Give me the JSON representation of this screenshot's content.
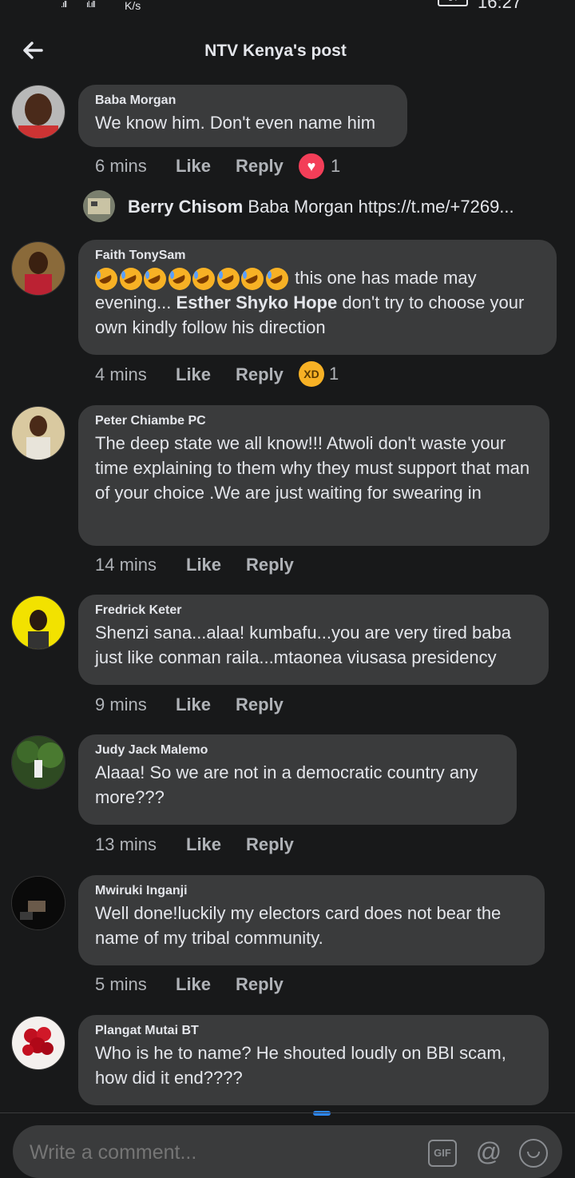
{
  "status_bar": {
    "speed": "K/s",
    "signal1": ".ıll",
    "signal2": "ıl.ıll",
    "battery": "54",
    "time": "16:27"
  },
  "header": {
    "title": "NTV Kenya's post"
  },
  "comments": [
    {
      "author": "Baba Morgan",
      "text": "We know him. Don't even name him",
      "time": "6 mins",
      "like": "Like",
      "reply": "Reply",
      "reaction_count": "1"
    },
    {
      "author": "Faith TonySam",
      "text_after_emoji": " this one has made may evening... ",
      "mention": "Esther Shyko Hope",
      "text_end": " don't try to choose your own kindly follow his direction",
      "time": "4 mins",
      "like": "Like",
      "reply": "Reply",
      "reaction_count": "1"
    },
    {
      "author": "Peter Chiambe PC",
      "text": "The deep state we all know!!! Atwoli don't waste your time explaining to them why they must support that man of your choice .We are just waiting for swearing in",
      "time": "14 mins",
      "like": "Like",
      "reply": "Reply"
    },
    {
      "author": "Fredrick Keter",
      "text": "Shenzi sana...alaa! kumbafu...you are very tired baba just like conman raila...mtaonea viusasa presidency",
      "time": "9 mins",
      "like": "Like",
      "reply": "Reply"
    },
    {
      "author": "Judy Jack Malemo",
      "text": "Alaaa! So we are not in a democratic country any more???",
      "time": "13 mins",
      "like": "Like",
      "reply": "Reply"
    },
    {
      "author": "Mwiruki Inganji",
      "text": "Well done!luckily my electors card does not bear the name of my tribal community.",
      "time": "5 mins",
      "like": "Like",
      "reply": "Reply"
    },
    {
      "author": "Plangat Mutai BT",
      "text": "Who is he to name?  He shouted loudly on BBI scam, how did it end????"
    }
  ],
  "nested_reply": {
    "author": "Berry Chisom",
    "text": " Baba Morgan https://t.me/+7269..."
  },
  "composer": {
    "placeholder": "Write a comment...",
    "gif": "GIF",
    "at": "@"
  }
}
